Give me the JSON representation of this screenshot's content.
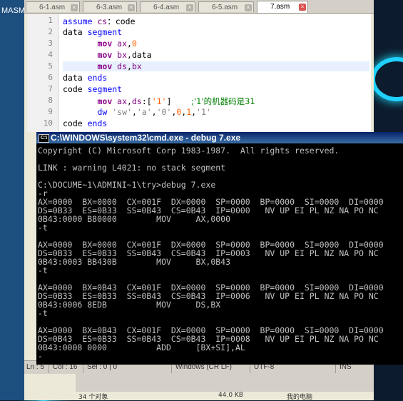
{
  "left_window": {
    "label": "MASM"
  },
  "tabs": [
    {
      "label": "6-1.asm",
      "active": false
    },
    {
      "label": "6-3.asm",
      "active": false
    },
    {
      "label": "6-4.asm",
      "active": false
    },
    {
      "label": "6-5.asm",
      "active": false
    },
    {
      "label": "7.asm",
      "active": true
    }
  ],
  "editor": {
    "lines": [
      {
        "n": "1",
        "tokens": [
          [
            "kw",
            "assume "
          ],
          [
            "reg",
            "cs"
          ],
          [
            "",
            "："
          ],
          [
            "",
            "code"
          ]
        ]
      },
      {
        "n": "2",
        "tokens": [
          [
            "",
            "data "
          ],
          [
            "kw",
            "segment"
          ]
        ]
      },
      {
        "n": "3",
        "tokens": [
          [
            "",
            "       "
          ],
          [
            "ins",
            "mov "
          ],
          [
            "reg",
            "ax"
          ],
          [
            "",
            ","
          ],
          [
            "num",
            "0"
          ]
        ]
      },
      {
        "n": "4",
        "tokens": [
          [
            "",
            "       "
          ],
          [
            "ins",
            "mov "
          ],
          [
            "reg",
            "bx"
          ],
          [
            "",
            ",data"
          ]
        ]
      },
      {
        "n": "5",
        "tokens": [
          [
            "",
            "       "
          ],
          [
            "ins",
            "mov "
          ],
          [
            "reg",
            "ds"
          ],
          [
            "",
            ","
          ],
          [
            "reg",
            "bx"
          ]
        ],
        "highlight": true
      },
      {
        "n": "6",
        "tokens": [
          [
            "",
            "data "
          ],
          [
            "kw",
            "ends"
          ]
        ]
      },
      {
        "n": "7",
        "tokens": [
          [
            "",
            "code "
          ],
          [
            "kw",
            "segment"
          ]
        ]
      },
      {
        "n": "8",
        "tokens": [
          [
            "",
            "       "
          ],
          [
            "ins",
            "mov "
          ],
          [
            "reg",
            "ax"
          ],
          [
            "",
            ","
          ],
          [
            "reg",
            "ds"
          ],
          [
            "",
            ":["
          ],
          [
            "num",
            "'1'"
          ],
          [
            "",
            "]    "
          ],
          [
            "cm",
            ";'1'的机器码是31"
          ]
        ]
      },
      {
        "n": "9",
        "tokens": [
          [
            "",
            "       "
          ],
          [
            "kw",
            "dw "
          ],
          [
            "str",
            "'sw'"
          ],
          [
            "",
            ","
          ],
          [
            "str",
            "'a'"
          ],
          [
            "",
            ","
          ],
          [
            "str",
            "'0'"
          ],
          [
            "",
            ","
          ],
          [
            "num",
            "0"
          ],
          [
            "",
            ","
          ],
          [
            "num",
            "1"
          ],
          [
            "",
            ","
          ],
          [
            "str",
            "'1'"
          ]
        ]
      },
      {
        "n": "10",
        "tokens": [
          [
            "",
            "code "
          ],
          [
            "kw",
            "ends"
          ]
        ]
      }
    ]
  },
  "statusbar": {
    "position": "Ln : 5",
    "col": "Col : 16",
    "sel": "Sel : 0 | 0",
    "eol": "Windows (CR LF)",
    "encoding": "UTF-8",
    "mode": "INS"
  },
  "taskbar": {
    "row_left": "34 个对象",
    "row_mid": "44.0 KB",
    "row_right": "我的电脑"
  },
  "cmd": {
    "title": "C:\\WINDOWS\\system32\\cmd.exe - debug 7.exe",
    "icon_label": "C:\\",
    "lines": [
      "Copyright (C) Microsoft Corp 1983-1987.  All rights reserved.",
      "",
      "LINK : warning L4021: no stack segment",
      "",
      "C:\\DOCUME~1\\ADMINI~1\\try>debug 7.exe",
      "-r",
      "AX=0000  BX=0000  CX=001F  DX=0000  SP=0000  BP=0000  SI=0000  DI=0000",
      "DS=0B33  ES=0B33  SS=0B43  CS=0B43  IP=0000   NV UP EI PL NZ NA PO NC",
      "0B43:0000 B80000        MOV     AX,0000",
      "-t",
      "",
      "AX=0000  BX=0000  CX=001F  DX=0000  SP=0000  BP=0000  SI=0000  DI=0000",
      "DS=0B33  ES=0B33  SS=0B43  CS=0B43  IP=0003   NV UP EI PL NZ NA PO NC",
      "0B43:0003 BB430B        MOV     BX,0B43",
      "-t",
      "",
      "AX=0000  BX=0B43  CX=001F  DX=0000  SP=0000  BP=0000  SI=0000  DI=0000",
      "DS=0B33  ES=0B33  SS=0B43  CS=0B43  IP=0006   NV UP EI PL NZ NA PO NC",
      "0B43:0006 8EDB          MOV     DS,BX",
      "-t",
      "",
      "AX=0000  BX=0B43  CX=001F  DX=0000  SP=0000  BP=0000  SI=0000  DI=0000",
      "DS=0B43  ES=0B33  SS=0B43  CS=0B43  IP=0008   NV UP EI PL NZ NA PO NC",
      "0B43:0008 0000          ADD     [BX+SI],AL",
      "-"
    ]
  }
}
